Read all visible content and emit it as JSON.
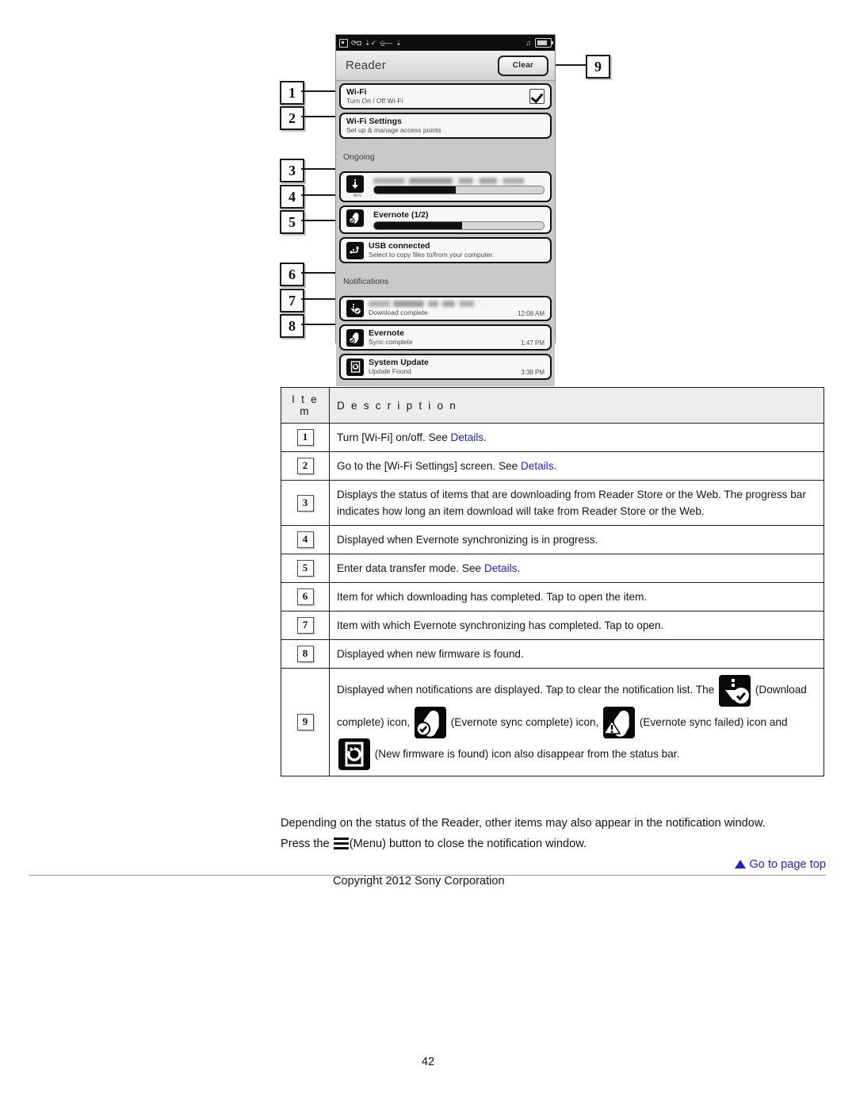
{
  "page": {
    "number": "42",
    "copyright": "Copyright 2012 Sony Corporation",
    "go_to_top": "Go to page top",
    "link_color": "#2020d0"
  },
  "figure": {
    "device": {
      "statusbar": {
        "left_icons": [
          "reader-icon",
          "sync-icon",
          "usb-icon",
          "download-icon",
          "link-icon",
          "download-icon-2"
        ],
        "right_icons": [
          "music-note-icon",
          "battery-icon"
        ]
      },
      "title": "Reader",
      "clear_button": "Clear",
      "settings": [
        {
          "title": "Wi-Fi",
          "subtitle": "Turn On / Off Wi-Fi",
          "checked": true
        },
        {
          "title": "Wi-Fi Settings",
          "subtitle": "Set up & manage access points",
          "checked": false
        }
      ],
      "ongoing_header": "Ongoing",
      "ongoing": [
        {
          "icon": "download-icon",
          "title": "",
          "title_blurred": true,
          "percent_label": "46%",
          "progress": 48
        },
        {
          "icon": "evernote-icon",
          "title": "Evernote (1/2)",
          "progress": 52
        },
        {
          "icon": "usb-icon",
          "title": "USB connected",
          "subtitle": "Select to copy files to/from your computer."
        }
      ],
      "notifications_header": "Notifications",
      "notifications": [
        {
          "icon": "download-complete-icon",
          "title": "",
          "title_blurred": true,
          "subtitle": "Download complete",
          "time": "12:08 AM"
        },
        {
          "icon": "evernote-icon",
          "title": "Evernote",
          "subtitle": "Sync complete",
          "time": "1:47 PM"
        },
        {
          "icon": "system-update-icon",
          "title": "System Update",
          "subtitle": "Update Found",
          "time": "3:38 PM"
        }
      ]
    },
    "callouts": [
      "1",
      "2",
      "3",
      "4",
      "5",
      "6",
      "7",
      "8",
      "9"
    ]
  },
  "table": {
    "headers": {
      "item": "I t e m",
      "description": "D e s c r i p t i o n"
    },
    "rows": [
      {
        "item": "1",
        "parts": [
          {
            "t": "Turn [Wi-Fi] on/off. See "
          },
          {
            "t": "Details",
            "link": true
          },
          {
            "t": "."
          }
        ]
      },
      {
        "item": "2",
        "parts": [
          {
            "t": "Go to the [Wi-Fi Settings] screen. See "
          },
          {
            "t": "Details",
            "link": true
          },
          {
            "t": "."
          }
        ]
      },
      {
        "item": "3",
        "parts": [
          {
            "t": "Displays the status of items that are downloading from Reader Store or the Web. The progress bar indicates how long an item download will take from Reader Store or the Web."
          }
        ]
      },
      {
        "item": "4",
        "parts": [
          {
            "t": "Displayed when Evernote synchronizing is in progress."
          }
        ]
      },
      {
        "item": "5",
        "parts": [
          {
            "t": "Enter data transfer mode. See "
          },
          {
            "t": "Details",
            "link": true
          },
          {
            "t": "."
          }
        ]
      },
      {
        "item": "6",
        "parts": [
          {
            "t": "Item for which downloading has completed. Tap to open the item."
          }
        ]
      },
      {
        "item": "7",
        "parts": [
          {
            "t": "Item with which Evernote synchronizing has completed. Tap to open."
          }
        ]
      },
      {
        "item": "8",
        "parts": [
          {
            "t": "Displayed when new firmware is found."
          }
        ]
      }
    ],
    "row9": {
      "item": "9",
      "seg1": "Displayed when notifications are displayed. Tap to clear the notification list. The ",
      "icon1": "download-complete-icon",
      "seg2": " (Download complete) icon, ",
      "icon2": "evernote-sync-complete-icon",
      "seg3": " (Evernote sync complete) icon, ",
      "icon3": "evernote-sync-failed-icon",
      "seg4": " (Evernote sync failed) icon and ",
      "icon4": "new-firmware-found-icon",
      "seg5": " (New firmware is found) icon also disappear from the status bar."
    }
  },
  "notes": {
    "line1": "Depending on the status of the Reader, other items may also appear in the notification window.",
    "line2_pre": "Press the ",
    "line2_post": "(Menu) button to close the notification window."
  }
}
